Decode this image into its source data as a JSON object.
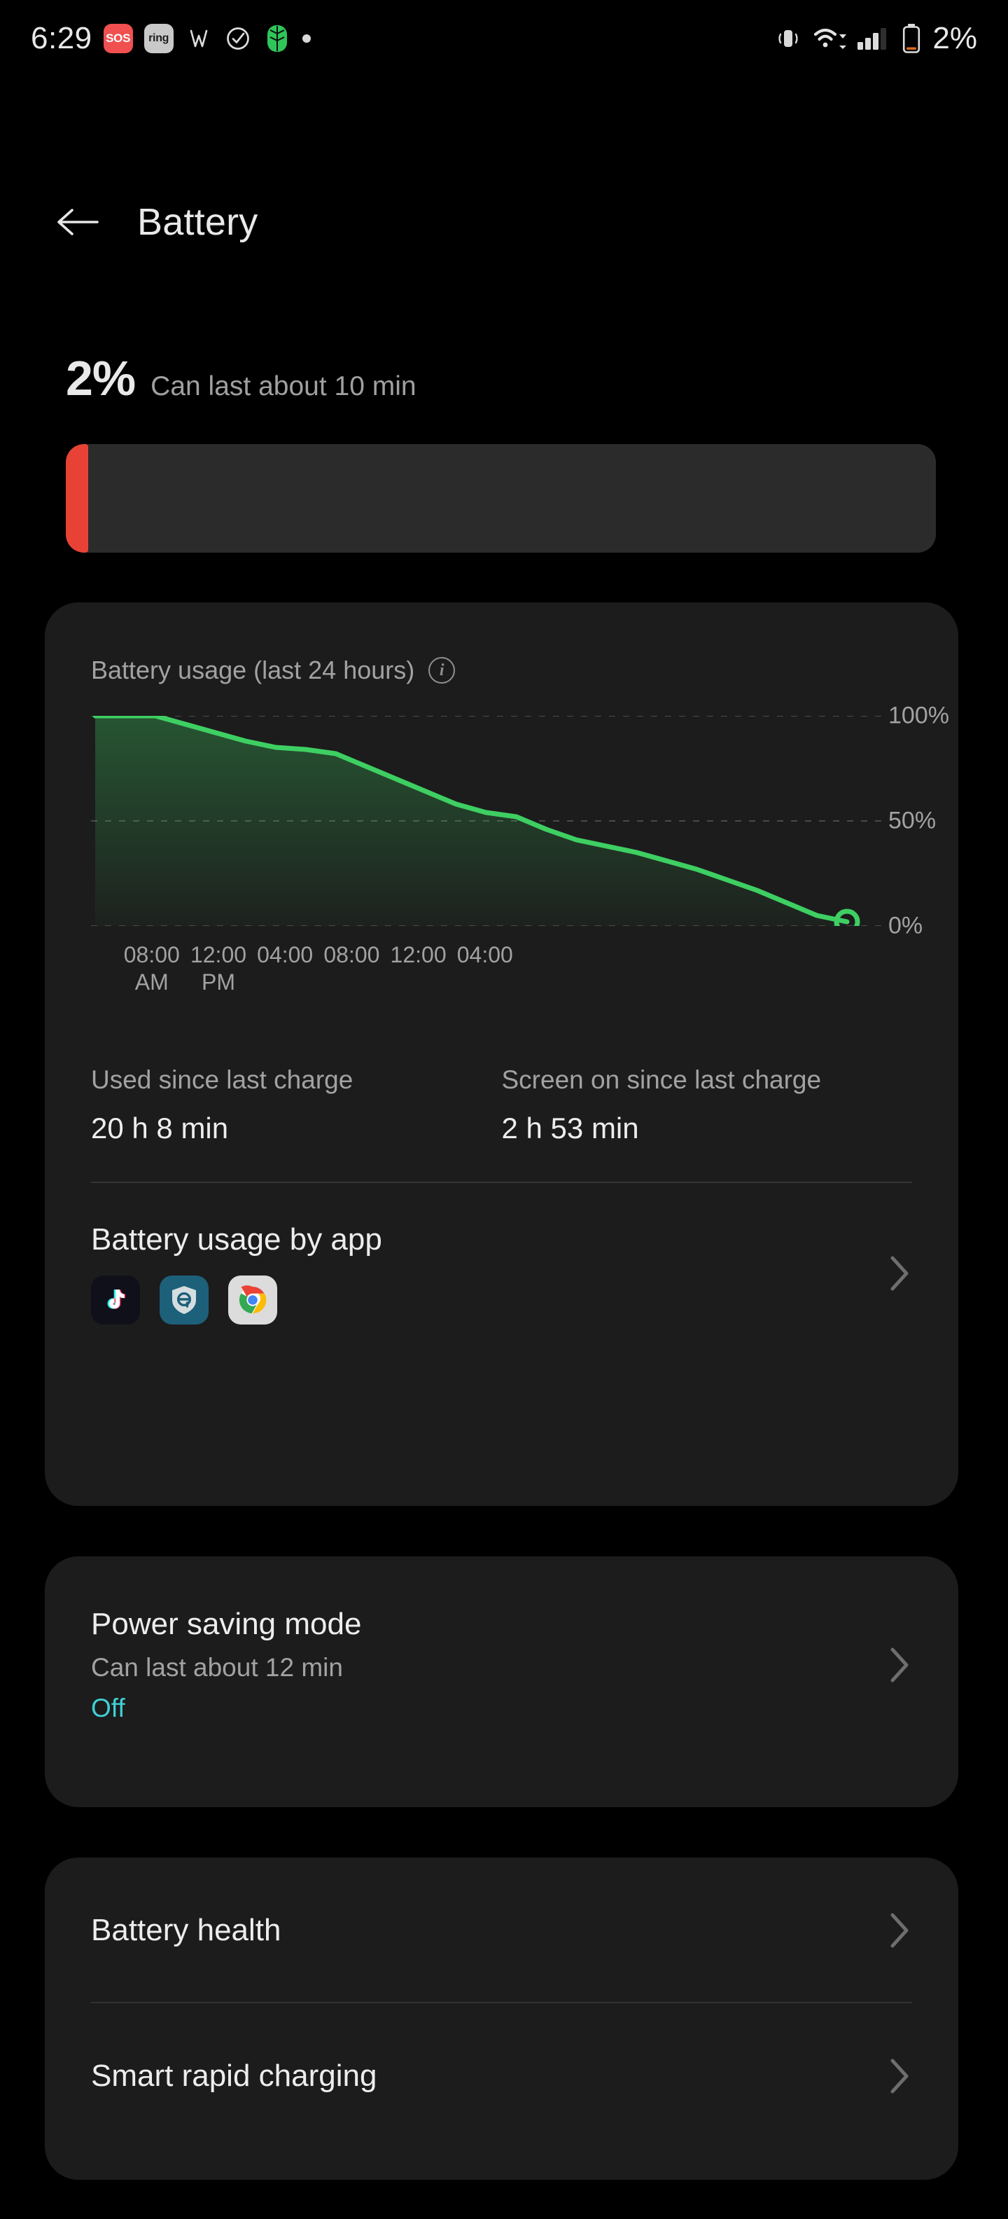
{
  "statusbar": {
    "time": "6:29",
    "sos_badge": "SOS",
    "ring_badge": "ring",
    "battery_text": "2%",
    "icons": [
      "sos-badge-icon",
      "ring-badge-icon",
      "w-app-icon",
      "check-circle-icon",
      "green-leaf-app-icon",
      "notification-dot-icon",
      "vibrate-icon",
      "wifi-icon",
      "signal-bars-icon",
      "battery-icon"
    ]
  },
  "header": {
    "back_label": "back",
    "title": "Battery"
  },
  "summary": {
    "percent": "2%",
    "percent_value": 2,
    "estimate": "Can last about 10 min",
    "bar_fill_color": "#e84236",
    "bar_track_color": "#2b2b2b"
  },
  "usage_card": {
    "title": "Battery usage (last 24 hours)",
    "info_icon": "info-icon",
    "stats": [
      {
        "label": "Used since last charge",
        "value": "20 h 8 min"
      },
      {
        "label": "Screen on since last charge",
        "value": "2 h 53 min"
      }
    ],
    "by_app": {
      "title": "Battery usage by app",
      "apps": [
        "tiktok-app-icon",
        "shield-e-app-icon",
        "chrome-app-icon"
      ],
      "chevron": "chevron-right-icon"
    }
  },
  "power_saving": {
    "title": "Power saving mode",
    "subtitle": "Can last about 12 min",
    "state": "Off",
    "state_color": "#3fd0d4",
    "chevron": "chevron-right-icon"
  },
  "more_items": [
    {
      "title": "Battery health",
      "chevron": "chevron-right-icon"
    },
    {
      "title": "Smart rapid charging",
      "chevron": "chevron-right-icon"
    }
  ],
  "chart_data": {
    "type": "area",
    "title": "Battery usage (last 24 hours)",
    "xlabel": "",
    "ylabel": "",
    "ylim": [
      0,
      100
    ],
    "grid": true,
    "legend": false,
    "line_color": "#3ecf62",
    "fill_color_top": "rgba(62,207,98,0.30)",
    "fill_color_bottom": "rgba(62,207,98,0.04)",
    "ytick_labels": [
      "100%",
      "50%",
      "0%"
    ],
    "ytick_values": [
      100,
      50,
      0
    ],
    "xtick_labels": [
      "08:00\nAM",
      "12:00\nPM",
      "04:00",
      "08:00",
      "12:00",
      "04:00"
    ],
    "xticks": [
      "08:00 AM",
      "12:00 PM",
      "04:00",
      "08:00",
      "12:00",
      "04:00"
    ],
    "end_marker": {
      "value": 2,
      "label": "0%",
      "style": "hollow-circle"
    },
    "x": [
      0,
      1,
      2,
      3,
      4,
      5,
      6,
      7,
      8,
      9,
      10,
      11,
      12,
      13,
      14,
      15,
      16,
      17,
      18,
      19,
      20,
      21,
      22,
      23,
      24
    ],
    "values": [
      100,
      100,
      100,
      96,
      92,
      88,
      85,
      84,
      82,
      76,
      70,
      64,
      58,
      54,
      52,
      46,
      41,
      38,
      35,
      31,
      27,
      22,
      17,
      11,
      5,
      2
    ]
  }
}
